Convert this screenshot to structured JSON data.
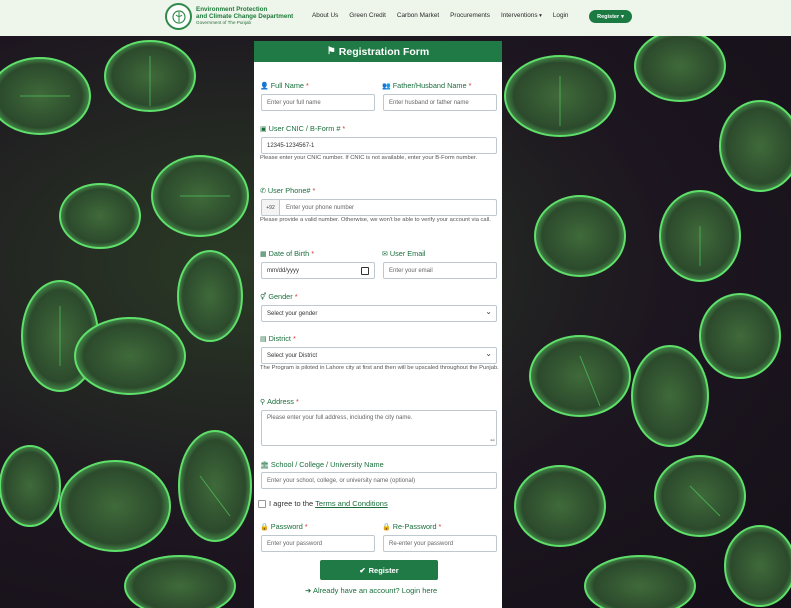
{
  "header": {
    "logo_line1": "Environment Protection",
    "logo_line2": "and Climate Change Department",
    "logo_line3": "Government of The Punjab",
    "nav": [
      "About Us",
      "Green Credit",
      "Carbon Market",
      "Procurements",
      "Interventions",
      "Login"
    ],
    "register_label": "Register"
  },
  "form": {
    "title": "Registration Form",
    "full_name_label": "Full Name",
    "full_name_placeholder": "Enter your full name",
    "father_label": "Father/Husband Name",
    "father_placeholder": "Enter husband or father name",
    "cnic_label": "User CNIC / B-Form #",
    "cnic_placeholder": "12345-1234567-1",
    "cnic_help": "Please enter your CNIC number. If CNIC is not available, enter your B-Form number.",
    "phone_label": "User Phone#",
    "phone_prefix": "+92",
    "phone_placeholder": "Enter your phone number",
    "phone_help": "Please provide a valid number. Otherwise, we won't be able to verify your account via call.",
    "dob_label": "Date of Birth",
    "dob_placeholder": "mm/dd/yyyy",
    "email_label": "User Email",
    "email_placeholder": "Enter your email",
    "gender_label": "Gender",
    "gender_value": "Select your gender",
    "district_label": "District",
    "district_value": "Select your District",
    "district_help": "The Program is piloted in Lahore city at first and then will be upscaled throughout the Punjab.",
    "address_label": "Address",
    "address_placeholder": "Please enter your full address, including the city name.",
    "school_label": "School / College / University Name",
    "school_placeholder": "Enter your school, college, or university name (optional)",
    "agree_text": "I agree to the",
    "terms_link": "Terms and Conditions",
    "password_label": "Password",
    "password_placeholder": "Enter your password",
    "repassword_label": "Re-Password",
    "repassword_placeholder": "Re-enter your password",
    "submit_label": "Register",
    "login_link": "Already have an account? Login here",
    "required_mark": "*"
  }
}
